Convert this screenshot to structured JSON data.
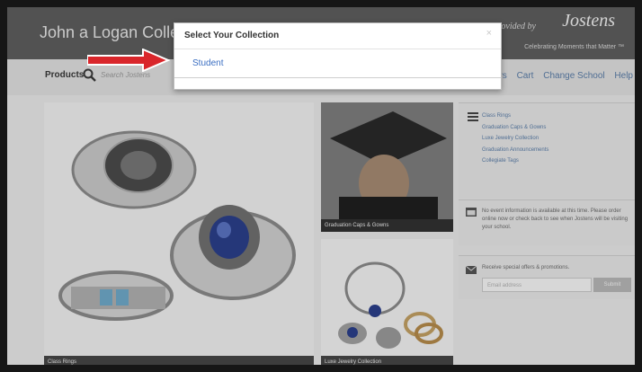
{
  "header": {
    "site_title": "John a Logan Colleg",
    "provided_by": "Provided by",
    "brand": "Jostens",
    "tagline": "Celebrating Moments that Matter ™"
  },
  "nav": {
    "products": "Products",
    "search_placeholder": "Search Jostens",
    "links": [
      "ders",
      "Cart",
      "Change School",
      "Help"
    ]
  },
  "panels": {
    "class_rings": "Class Rings",
    "caps_gowns": "Graduation Caps & Gowns",
    "luxe_jewelry": "Luxe Jewelry Collection"
  },
  "sidebar": {
    "links": [
      "Class Rings",
      "Graduation Caps & Gowns",
      "Luxe Jewelry Collection",
      "Graduation Announcements",
      "Collegiate Tags"
    ],
    "event_text": "No event information is available at this time. Please order online now or check back to see when Jostens will be visiting your school.",
    "offers_text": "Receive special offers & promotions.",
    "email_placeholder": "Email address",
    "submit": "Submit"
  },
  "modal": {
    "title": "Select Your Collection",
    "close": "×",
    "option": "Student"
  },
  "colors": {
    "header_bg": "#5e5e5e",
    "link": "#5a7da8",
    "arrow": "#d9262b"
  }
}
